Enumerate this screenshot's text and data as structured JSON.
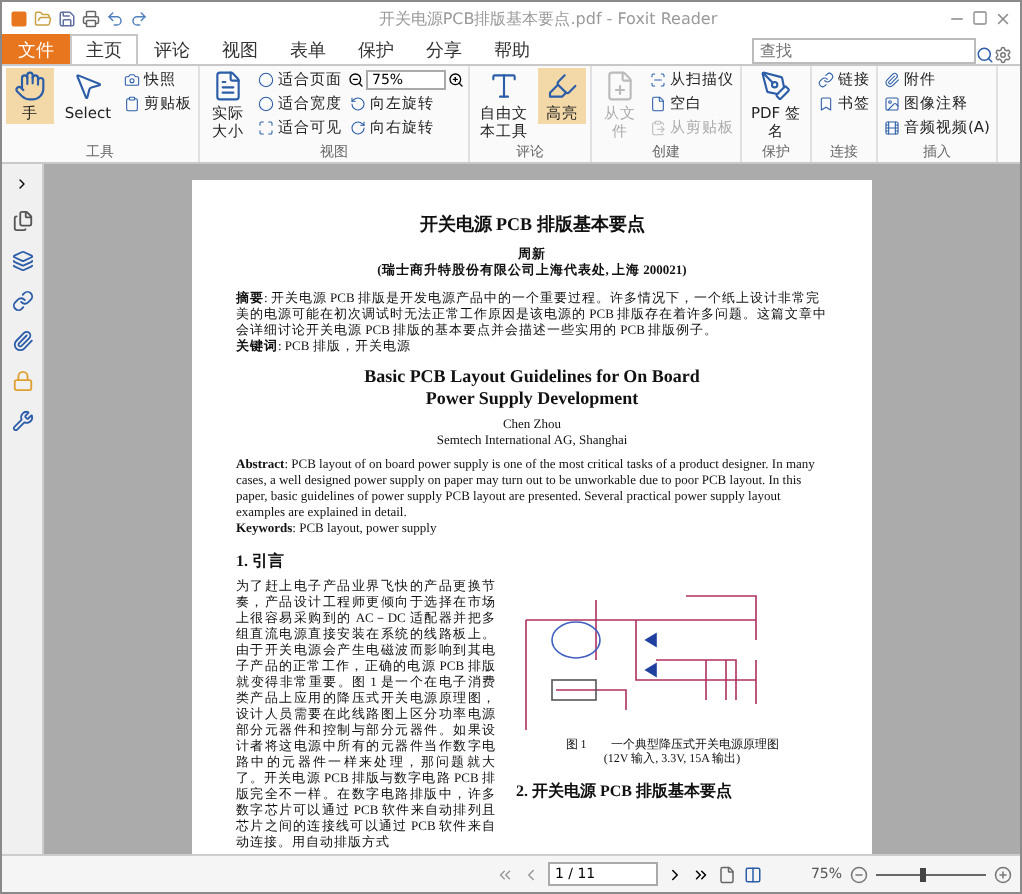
{
  "window": {
    "title": "开关电源PCB排版基本要点.pdf - Foxit Reader"
  },
  "menu_tabs": [
    {
      "label": "文件",
      "kind": "file",
      "selected": false
    },
    {
      "label": "主页",
      "kind": "tab",
      "selected": true
    },
    {
      "label": "评论",
      "kind": "tab",
      "selected": false
    },
    {
      "label": "视图",
      "kind": "tab",
      "selected": false
    },
    {
      "label": "表单",
      "kind": "tab",
      "selected": false
    },
    {
      "label": "保护",
      "kind": "tab",
      "selected": false
    },
    {
      "label": "分享",
      "kind": "tab",
      "selected": false
    },
    {
      "label": "帮助",
      "kind": "tab",
      "selected": false
    }
  ],
  "search": {
    "placeholder": "查找"
  },
  "ribbon_groups": [
    {
      "label": "工具",
      "columns": [
        [
          {
            "kind": "large",
            "label": "手",
            "selected": true
          }
        ],
        [
          {
            "kind": "large",
            "label": "Select",
            "selected": false
          }
        ],
        [
          {
            "kind": "small",
            "label": "快照"
          },
          {
            "kind": "small",
            "label": "剪贴板"
          }
        ]
      ]
    },
    {
      "label": "视图",
      "columns": [
        [
          {
            "kind": "large",
            "label": "实际大小",
            "selected": false
          }
        ],
        [
          {
            "kind": "radio",
            "label": "适合页面"
          },
          {
            "kind": "radio",
            "label": "适合宽度"
          },
          {
            "kind": "small",
            "label": "适合可见"
          }
        ],
        [
          {
            "kind": "zoom",
            "value": "75%"
          },
          {
            "kind": "small",
            "label": "向左旋转"
          },
          {
            "kind": "small",
            "label": "向右旋转"
          }
        ]
      ]
    },
    {
      "label": "评论",
      "columns": [
        [
          {
            "kind": "large",
            "label": "自由文本工具",
            "selected": false
          }
        ],
        [
          {
            "kind": "large",
            "label": "高亮",
            "selected": true
          }
        ]
      ]
    },
    {
      "label": "创建",
      "columns": [
        [
          {
            "kind": "large",
            "label": "从文件",
            "selected": false,
            "disabled": true
          }
        ],
        [
          {
            "kind": "small",
            "label": "从扫描仪"
          },
          {
            "kind": "small",
            "label": "空白"
          },
          {
            "kind": "small",
            "label": "从剪贴板",
            "disabled": true
          }
        ]
      ]
    },
    {
      "label": "保护",
      "columns": [
        [
          {
            "kind": "large",
            "label": "PDF 签名",
            "selected": false
          }
        ]
      ]
    },
    {
      "label": "连接",
      "columns": [
        [
          {
            "kind": "small",
            "label": "链接"
          },
          {
            "kind": "small",
            "label": "书签"
          }
        ]
      ]
    },
    {
      "label": "插入",
      "columns": [
        [
          {
            "kind": "small",
            "label": "附件"
          },
          {
            "kind": "small",
            "label": "图像注释"
          },
          {
            "kind": "small",
            "label": "音频视频(A)"
          }
        ]
      ]
    }
  ],
  "document": {
    "title": "开关电源 PCB 排版基本要点",
    "author": "周新",
    "affiliation": "(瑞士商升特股份有限公司上海代表处, 上海 200021)",
    "abstract_cn": "**摘要**: 开关电源 PCB 排版是开发电源产品中的一个重要过程。许多情况下，一个纸上设计非常完美的电源可能在初次调试时无法正常工作原因是该电源的 PCB 排版存在着许多问题。这篇文章中会详细讨论开关电源 PCB 排版的基本要点并会描述一些实用的 PCB 排版例子。",
    "keywords_cn": "**关键词**: PCB 排版，开关电源",
    "title_en": [
      "Basic PCB Layout Guidelines for On Board",
      "Power Supply Development"
    ],
    "author_en": "Chen Zhou",
    "affiliation_en": "Semtech International AG, Shanghai",
    "abstract_en": "**Abstract**: PCB layout of on board power supply is one of the most critical tasks of a product designer. In many cases, a well designed power supply on paper may turn out to be unworkable due to poor PCB layout. In this paper, basic guidelines of power supply PCB layout are presented. Several practical power supply layout examples are explained in detail.",
    "keywords_en": "**Keywords**: PCB layout, power supply",
    "section_1": "1. 引言",
    "body": "为了赶上电子产品业界飞快的产品更换节奏，产品设计工程师更倾向于选择在市场上很容易采购到的 AC－DC 适配器并把多组直流电源直接安装在系统的线路板上。由于开关电源会产生电磁波而影响到其电子产品的正常工作，正确的电源 PCB 排版就变得非常重要。图 1 是一个在电子消费类产品上应用的降压式开关电源原理图，设计人员需要在此线路图上区分功率电源部分元器件和控制与部分元器件。如果设计者将这电源中所有的元器件当作数字电路中的元器件一样来处理，那问题就大了。开关电源 PCB 排版与数字电路 PCB 排版完全不一样。在数字电路排版中，许多数字芯片可以通过 PCB 软件来自动排列且芯片之间的连接线可以通过 PCB 软件来自动连接。用自动排版方式",
    "figure_caption": [
      "图 1　　一个典型降压式开关电源原理图",
      "(12V 输入, 3.3V, 15A 输出)"
    ],
    "section_2": "2. 开关电源 PCB 排版基本要点"
  },
  "status_bar": {
    "page": "1 / 11",
    "zoom": "75%",
    "zoom_slider": {
      "level": 0.4
    }
  }
}
